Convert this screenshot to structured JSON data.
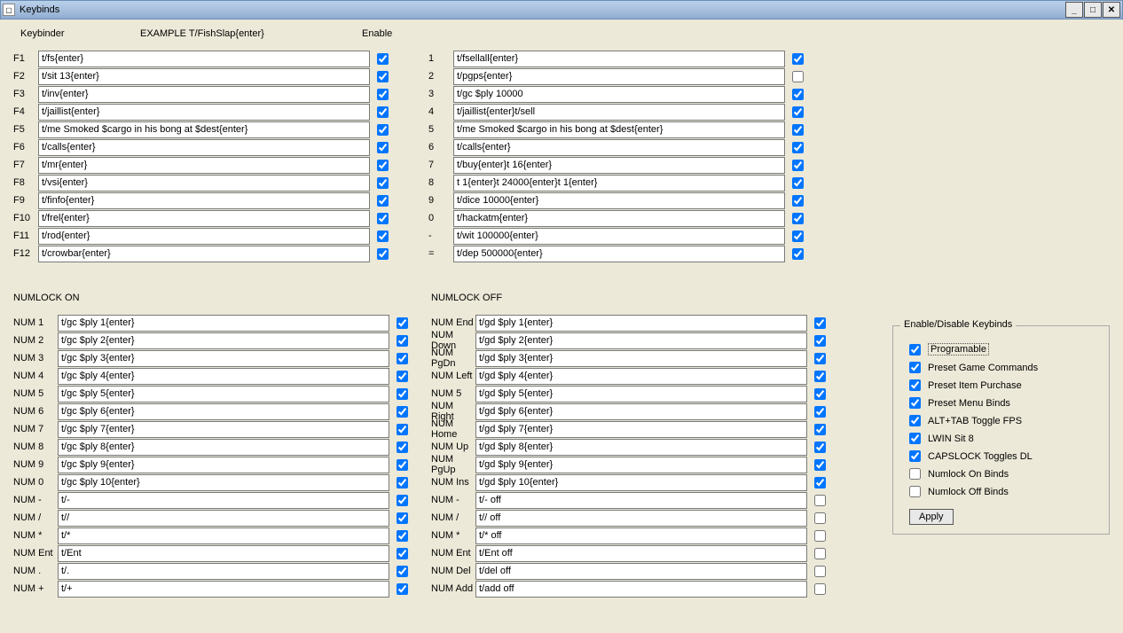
{
  "window": {
    "title": "Keybinds"
  },
  "header": {
    "keybinder": "Keybinder",
    "example": "EXAMPLE   T/FishSlap{enter}",
    "enable": "Enable"
  },
  "f": [
    {
      "k": "F1",
      "v": "t/fs{enter}",
      "e": true
    },
    {
      "k": "F2",
      "v": "t/sit 13{enter}",
      "e": true
    },
    {
      "k": "F3",
      "v": "t/inv{enter}",
      "e": true
    },
    {
      "k": "F4",
      "v": "t/jaillist{enter}",
      "e": true
    },
    {
      "k": "F5",
      "v": "t/me Smoked $cargo in his bong at $dest{enter}",
      "e": true
    },
    {
      "k": "F6",
      "v": "t/calls{enter}",
      "e": true
    },
    {
      "k": "F7",
      "v": "t/mr{enter}",
      "e": true
    },
    {
      "k": "F8",
      "v": "t/vsi{enter}",
      "e": true
    },
    {
      "k": "F9",
      "v": "t/finfo{enter}",
      "e": true
    },
    {
      "k": "F10",
      "v": "t/frel{enter}",
      "e": true
    },
    {
      "k": "F11",
      "v": "t/rod{enter}",
      "e": true
    },
    {
      "k": "F12",
      "v": "t/crowbar{enter}",
      "e": true
    }
  ],
  "num": [
    {
      "k": "1",
      "v": "t/fsellall{enter}",
      "e": true
    },
    {
      "k": "2",
      "v": "t/pgps{enter}",
      "e": false
    },
    {
      "k": "3",
      "v": "t/gc $ply 10000",
      "e": true
    },
    {
      "k": "4",
      "v": "t/jaillist{enter}t/sell",
      "e": true
    },
    {
      "k": "5",
      "v": "t/me Smoked $cargo in his bong at $dest{enter}",
      "e": true
    },
    {
      "k": "6",
      "v": "t/calls{enter}",
      "e": true
    },
    {
      "k": "7",
      "v": "t/buy{enter}t 16{enter}",
      "e": true
    },
    {
      "k": "8",
      "v": "t 1{enter}t 24000{enter}t 1{enter}",
      "e": true
    },
    {
      "k": "9",
      "v": "t/dice 10000{enter}",
      "e": true
    },
    {
      "k": "0",
      "v": "t/hackatm{enter}",
      "e": true
    },
    {
      "k": "-",
      "v": "t/wit 100000{enter}",
      "e": true
    },
    {
      "k": "=",
      "v": "t/dep 500000{enter}",
      "e": true
    }
  ],
  "numlock_on_title": "NUMLOCK ON",
  "numlock_off_title": "NUMLOCK OFF",
  "non": [
    {
      "k": "NUM 1",
      "v": "t/gc $ply 1{enter}",
      "e": true
    },
    {
      "k": "NUM 2",
      "v": "t/gc $ply 2{enter}",
      "e": true
    },
    {
      "k": "NUM 3",
      "v": "t/gc $ply 3{enter}",
      "e": true
    },
    {
      "k": "NUM 4",
      "v": "t/gc $ply 4{enter}",
      "e": true
    },
    {
      "k": "NUM 5",
      "v": "t/gc $ply 5{enter}",
      "e": true
    },
    {
      "k": "NUM 6",
      "v": "t/gc $ply 6{enter}",
      "e": true
    },
    {
      "k": "NUM 7",
      "v": "t/gc $ply 7{enter}",
      "e": true
    },
    {
      "k": "NUM 8",
      "v": "t/gc $ply 8{enter}",
      "e": true
    },
    {
      "k": "NUM 9",
      "v": "t/gc $ply 9{enter}",
      "e": true
    },
    {
      "k": "NUM 0",
      "v": "t/gc $ply 10{enter}",
      "e": true
    },
    {
      "k": "NUM -",
      "v": "t/-",
      "e": true
    },
    {
      "k": "NUM /",
      "v": "t//",
      "e": true
    },
    {
      "k": "NUM *",
      "v": "t/*",
      "e": true
    },
    {
      "k": "NUM Ent",
      "v": "t/Ent",
      "e": true
    },
    {
      "k": "NUM .",
      "v": "t/.",
      "e": true
    },
    {
      "k": "NUM +",
      "v": "t/+",
      "e": true
    }
  ],
  "noff": [
    {
      "k": "NUM End",
      "v": "t/gd $ply 1{enter}",
      "e": true
    },
    {
      "k": "NUM Down",
      "v": "t/gd $ply 2{enter}",
      "e": true
    },
    {
      "k": "NUM PgDn",
      "v": "t/gd $ply 3{enter}",
      "e": true
    },
    {
      "k": "NUM Left",
      "v": "t/gd $ply 4{enter}",
      "e": true
    },
    {
      "k": "NUM 5",
      "v": "t/gd $ply 5{enter}",
      "e": true
    },
    {
      "k": "NUM Right",
      "v": "t/gd $ply 6{enter}",
      "e": true
    },
    {
      "k": "NUM Home",
      "v": "t/gd $ply 7{enter}",
      "e": true
    },
    {
      "k": "NUM Up",
      "v": "t/gd $ply 8{enter}",
      "e": true
    },
    {
      "k": "NUM PgUp",
      "v": "t/gd $ply 9{enter}",
      "e": true
    },
    {
      "k": "NUM Ins",
      "v": "t/gd $ply 10{enter}",
      "e": true
    },
    {
      "k": "NUM -",
      "v": "t/- off",
      "e": false
    },
    {
      "k": "NUM /",
      "v": "t// off",
      "e": false
    },
    {
      "k": "NUM *",
      "v": "t/* off",
      "e": false
    },
    {
      "k": "NUM Ent",
      "v": "t/Ent off",
      "e": false
    },
    {
      "k": "NUM Del",
      "v": "t/del off",
      "e": false
    },
    {
      "k": "NUM Add",
      "v": "t/add off",
      "e": false
    }
  ],
  "groupbox": {
    "title": "Enable/Disable Keybinds",
    "items": [
      {
        "label": "Programable",
        "checked": true,
        "focus": true
      },
      {
        "label": "Preset Game Commands",
        "checked": true
      },
      {
        "label": "Preset Item Purchase",
        "checked": true
      },
      {
        "label": "Preset Menu Binds",
        "checked": true
      },
      {
        "label": "ALT+TAB Toggle FPS",
        "checked": true
      },
      {
        "label": "LWIN Sit 8",
        "checked": true
      },
      {
        "label": "CAPSLOCK Toggles DL",
        "checked": true
      },
      {
        "label": "Numlock On Binds",
        "checked": false
      },
      {
        "label": "Numlock Off Binds",
        "checked": false
      }
    ],
    "apply": "Apply"
  }
}
